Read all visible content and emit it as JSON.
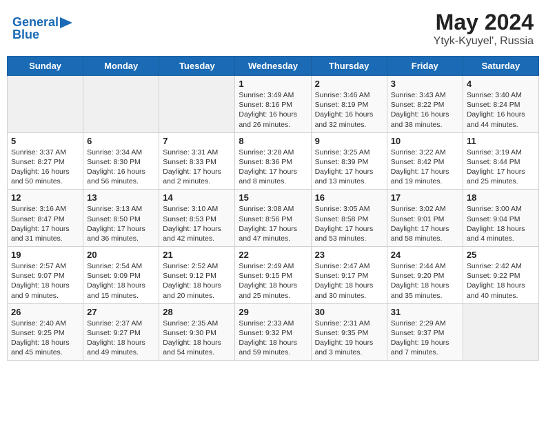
{
  "header": {
    "logo_line1": "General",
    "logo_line2": "Blue",
    "title": "May 2024",
    "subtitle": "Ytyk-Kyuyel', Russia"
  },
  "days_of_week": [
    "Sunday",
    "Monday",
    "Tuesday",
    "Wednesday",
    "Thursday",
    "Friday",
    "Saturday"
  ],
  "weeks": [
    [
      {
        "day": "",
        "info": ""
      },
      {
        "day": "",
        "info": ""
      },
      {
        "day": "",
        "info": ""
      },
      {
        "day": "1",
        "info": "Sunrise: 3:49 AM\nSunset: 8:16 PM\nDaylight: 16 hours\nand 26 minutes."
      },
      {
        "day": "2",
        "info": "Sunrise: 3:46 AM\nSunset: 8:19 PM\nDaylight: 16 hours\nand 32 minutes."
      },
      {
        "day": "3",
        "info": "Sunrise: 3:43 AM\nSunset: 8:22 PM\nDaylight: 16 hours\nand 38 minutes."
      },
      {
        "day": "4",
        "info": "Sunrise: 3:40 AM\nSunset: 8:24 PM\nDaylight: 16 hours\nand 44 minutes."
      }
    ],
    [
      {
        "day": "5",
        "info": "Sunrise: 3:37 AM\nSunset: 8:27 PM\nDaylight: 16 hours\nand 50 minutes."
      },
      {
        "day": "6",
        "info": "Sunrise: 3:34 AM\nSunset: 8:30 PM\nDaylight: 16 hours\nand 56 minutes."
      },
      {
        "day": "7",
        "info": "Sunrise: 3:31 AM\nSunset: 8:33 PM\nDaylight: 17 hours\nand 2 minutes."
      },
      {
        "day": "8",
        "info": "Sunrise: 3:28 AM\nSunset: 8:36 PM\nDaylight: 17 hours\nand 8 minutes."
      },
      {
        "day": "9",
        "info": "Sunrise: 3:25 AM\nSunset: 8:39 PM\nDaylight: 17 hours\nand 13 minutes."
      },
      {
        "day": "10",
        "info": "Sunrise: 3:22 AM\nSunset: 8:42 PM\nDaylight: 17 hours\nand 19 minutes."
      },
      {
        "day": "11",
        "info": "Sunrise: 3:19 AM\nSunset: 8:44 PM\nDaylight: 17 hours\nand 25 minutes."
      }
    ],
    [
      {
        "day": "12",
        "info": "Sunrise: 3:16 AM\nSunset: 8:47 PM\nDaylight: 17 hours\nand 31 minutes."
      },
      {
        "day": "13",
        "info": "Sunrise: 3:13 AM\nSunset: 8:50 PM\nDaylight: 17 hours\nand 36 minutes."
      },
      {
        "day": "14",
        "info": "Sunrise: 3:10 AM\nSunset: 8:53 PM\nDaylight: 17 hours\nand 42 minutes."
      },
      {
        "day": "15",
        "info": "Sunrise: 3:08 AM\nSunset: 8:56 PM\nDaylight: 17 hours\nand 47 minutes."
      },
      {
        "day": "16",
        "info": "Sunrise: 3:05 AM\nSunset: 8:58 PM\nDaylight: 17 hours\nand 53 minutes."
      },
      {
        "day": "17",
        "info": "Sunrise: 3:02 AM\nSunset: 9:01 PM\nDaylight: 17 hours\nand 58 minutes."
      },
      {
        "day": "18",
        "info": "Sunrise: 3:00 AM\nSunset: 9:04 PM\nDaylight: 18 hours\nand 4 minutes."
      }
    ],
    [
      {
        "day": "19",
        "info": "Sunrise: 2:57 AM\nSunset: 9:07 PM\nDaylight: 18 hours\nand 9 minutes."
      },
      {
        "day": "20",
        "info": "Sunrise: 2:54 AM\nSunset: 9:09 PM\nDaylight: 18 hours\nand 15 minutes."
      },
      {
        "day": "21",
        "info": "Sunrise: 2:52 AM\nSunset: 9:12 PM\nDaylight: 18 hours\nand 20 minutes."
      },
      {
        "day": "22",
        "info": "Sunrise: 2:49 AM\nSunset: 9:15 PM\nDaylight: 18 hours\nand 25 minutes."
      },
      {
        "day": "23",
        "info": "Sunrise: 2:47 AM\nSunset: 9:17 PM\nDaylight: 18 hours\nand 30 minutes."
      },
      {
        "day": "24",
        "info": "Sunrise: 2:44 AM\nSunset: 9:20 PM\nDaylight: 18 hours\nand 35 minutes."
      },
      {
        "day": "25",
        "info": "Sunrise: 2:42 AM\nSunset: 9:22 PM\nDaylight: 18 hours\nand 40 minutes."
      }
    ],
    [
      {
        "day": "26",
        "info": "Sunrise: 2:40 AM\nSunset: 9:25 PM\nDaylight: 18 hours\nand 45 minutes."
      },
      {
        "day": "27",
        "info": "Sunrise: 2:37 AM\nSunset: 9:27 PM\nDaylight: 18 hours\nand 49 minutes."
      },
      {
        "day": "28",
        "info": "Sunrise: 2:35 AM\nSunset: 9:30 PM\nDaylight: 18 hours\nand 54 minutes."
      },
      {
        "day": "29",
        "info": "Sunrise: 2:33 AM\nSunset: 9:32 PM\nDaylight: 18 hours\nand 59 minutes."
      },
      {
        "day": "30",
        "info": "Sunrise: 2:31 AM\nSunset: 9:35 PM\nDaylight: 19 hours\nand 3 minutes."
      },
      {
        "day": "31",
        "info": "Sunrise: 2:29 AM\nSunset: 9:37 PM\nDaylight: 19 hours\nand 7 minutes."
      },
      {
        "day": "",
        "info": ""
      }
    ]
  ]
}
